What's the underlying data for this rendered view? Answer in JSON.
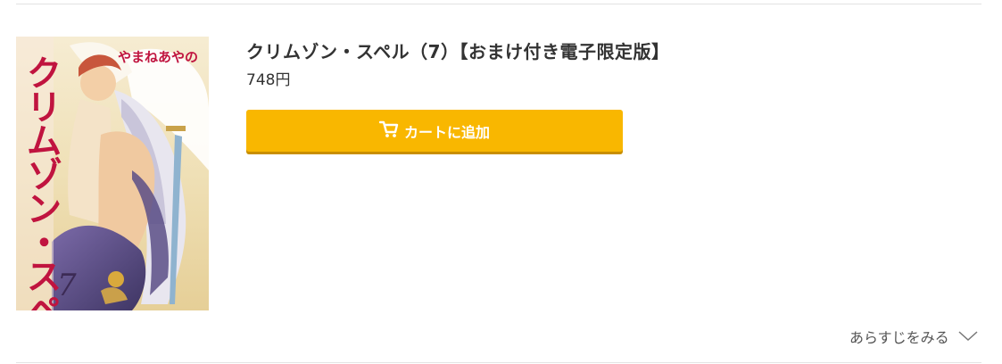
{
  "product": {
    "title": "クリムゾン・スペル（7）【おまけ付き電子限定版】",
    "price": "748円",
    "cover": {
      "title_text": "クリムゾン・スペル",
      "author_text": "やまねあやの",
      "volume_text": "7",
      "alt": "クリムゾン・スペル（7）表紙"
    }
  },
  "actions": {
    "cart_label": "カートに追加",
    "synopsis_label": "あらすじをみる"
  },
  "colors": {
    "accent": "#f9b700",
    "accent_shadow": "#c98f00",
    "divider": "#e3e3e3"
  },
  "icons": {
    "cart": "cart-icon",
    "expand": "chevron-down-icon"
  }
}
